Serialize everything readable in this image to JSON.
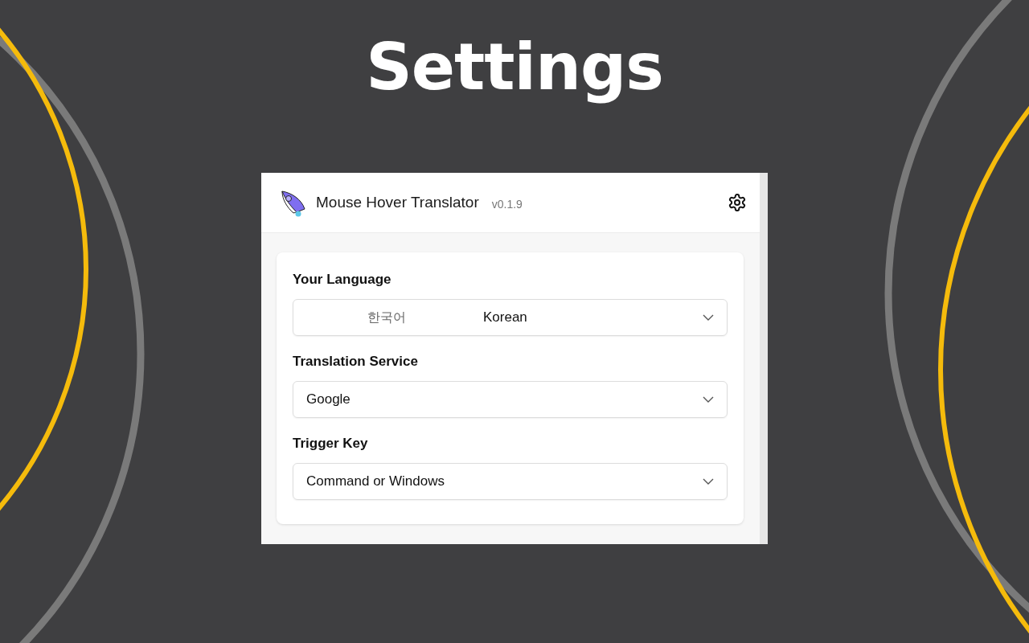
{
  "headline": "Settings",
  "app": {
    "name": "Mouse Hover Translator",
    "version": "v0.1.9"
  },
  "fields": [
    {
      "label": "Your Language",
      "native": "한국어",
      "value": "Korean"
    },
    {
      "label": "Translation Service",
      "value": "Google"
    },
    {
      "label": "Trigger Key",
      "value": "Command or Windows"
    }
  ]
}
